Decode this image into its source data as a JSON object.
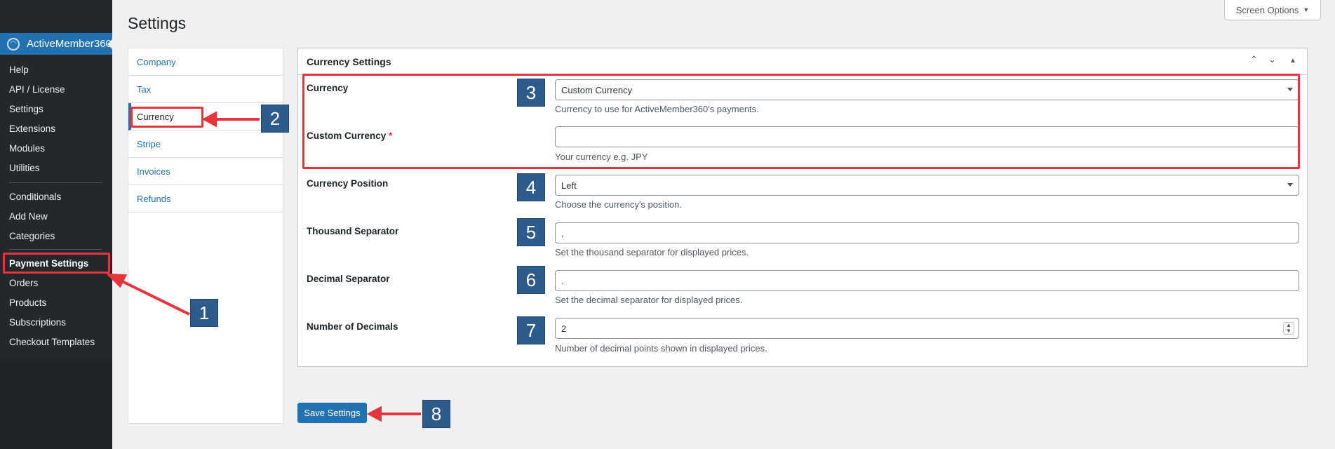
{
  "sidebar": {
    "plugin_name": "ActiveMember360",
    "items": [
      {
        "label": "Help"
      },
      {
        "label": "API / License"
      },
      {
        "label": "Settings"
      },
      {
        "label": "Extensions"
      },
      {
        "label": "Modules"
      },
      {
        "label": "Utilities"
      },
      {
        "label": "Conditionals"
      },
      {
        "label": "Add New"
      },
      {
        "label": "Categories"
      },
      {
        "label": "Payment Settings",
        "active": true
      },
      {
        "label": "Orders"
      },
      {
        "label": "Products"
      },
      {
        "label": "Subscriptions"
      },
      {
        "label": "Checkout Templates"
      }
    ]
  },
  "header": {
    "title": "Settings",
    "screen_options": "Screen Options"
  },
  "tabs": [
    {
      "label": "Company"
    },
    {
      "label": "Tax"
    },
    {
      "label": "Currency",
      "current": true
    },
    {
      "label": "Stripe"
    },
    {
      "label": "Invoices"
    },
    {
      "label": "Refunds"
    }
  ],
  "postbox": {
    "title": "Currency Settings",
    "fields": {
      "currency": {
        "label": "Currency",
        "value": "Custom Currency",
        "description": "Currency to use for ActiveMember360's payments."
      },
      "custom_currency": {
        "label": "Custom Currency",
        "required_mark": "*",
        "value": "",
        "description": "Your currency e.g. JPY"
      },
      "position": {
        "label": "Currency Position",
        "value": "Left",
        "description": "Choose the currency's position."
      },
      "thousand": {
        "label": "Thousand Separator",
        "value": ",",
        "description": "Set the thousand separator for displayed prices."
      },
      "decimal": {
        "label": "Decimal Separator",
        "value": ".",
        "description": "Set the decimal separator for displayed prices."
      },
      "decimals": {
        "label": "Number of Decimals",
        "value": "2",
        "description": "Number of decimal points shown in displayed prices."
      }
    }
  },
  "save_button": "Save Settings",
  "annotations": {
    "badges": [
      "1",
      "2",
      "3",
      "4",
      "5",
      "6",
      "7",
      "8"
    ],
    "highlight_color": "#e5343c",
    "badge_color": "#2d5b8c"
  }
}
